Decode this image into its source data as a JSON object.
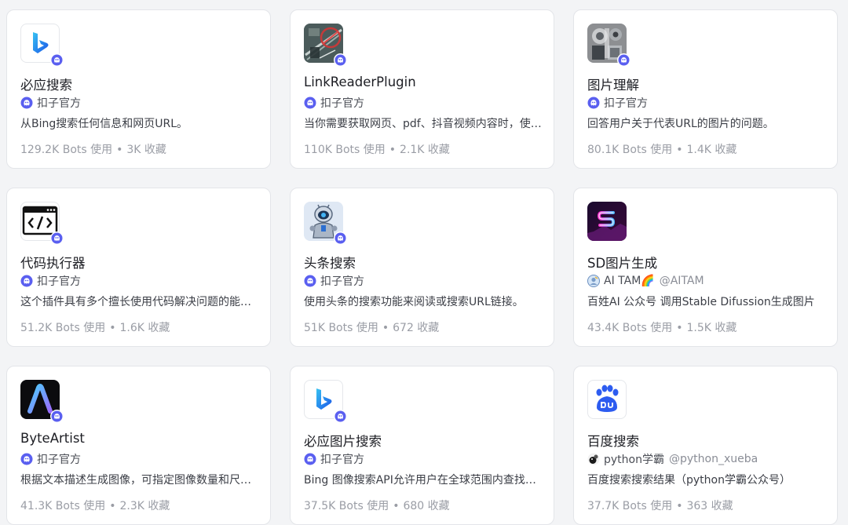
{
  "plugins": [
    {
      "icon": "bing-logo-icon",
      "title": "必应搜索",
      "author": "扣子官方",
      "description": "从Bing搜索任何信息和网页URL。",
      "bots": "129.2K Bots 使用",
      "favorites": "3K 收藏"
    },
    {
      "icon": "link-reader-icon",
      "title": "LinkReaderPlugin",
      "author": "扣子官方",
      "description": "当你需要获取网页、pdf、抖音视频内容时，使用此工具。",
      "bots": "110K Bots 使用",
      "favorites": "2.1K 收藏"
    },
    {
      "icon": "image-understanding-icon",
      "title": "图片理解",
      "author": "扣子官方",
      "description": "回答用户关于代表URL的图片的问题。",
      "bots": "80.1K Bots 使用",
      "favorites": "1.4K 收藏"
    },
    {
      "icon": "code-terminal-icon",
      "title": "代码执行器",
      "author": "扣子官方",
      "description": "这个插件具有多个擅长使用代码解决问题的能力。",
      "bots": "51.2K Bots 使用",
      "favorites": "1.6K 收藏"
    },
    {
      "icon": "robot-search-icon",
      "title": "头条搜索",
      "author": "扣子官方",
      "description": "使用头条的搜索功能来阅读或搜索URL链接。",
      "bots": "51K Bots 使用",
      "favorites": "672 收藏"
    },
    {
      "icon": "sd-generate-icon",
      "title": "SD图片生成",
      "author": "AI TAM🌈",
      "handle": "@AITAM",
      "description": "百姓AI 公众号 调用Stable Difussion生成图片",
      "bots": "43.4K Bots 使用",
      "favorites": "1.5K 收藏"
    },
    {
      "icon": "byteartist-logo-icon",
      "title": "ByteArtist",
      "author": "扣子官方",
      "description": "根据文本描述生成图像，可指定图像数量和尺寸。",
      "bots": "41.3K Bots 使用",
      "favorites": "2.3K 收藏"
    },
    {
      "icon": "bing-logo-icon",
      "title": "必应图片搜索",
      "author": "扣子官方",
      "description": "Bing 图像搜索API允许用户在全球范围内查找高质量的图片。",
      "bots": "37.5K Bots 使用",
      "favorites": "680 收藏"
    },
    {
      "icon": "baidu-logo-icon",
      "title": "百度搜索",
      "author": "python学霸",
      "handle": "@python_xueba",
      "description": "百度搜索搜索结果（python学霸公众号）",
      "bots": "37.7K Bots 使用",
      "favorites": "363 收藏"
    }
  ],
  "separator": "•",
  "colors": {
    "official_badge": "#5a5ff0",
    "bing_blue": "#1b6ff5",
    "baidu_blue": "#2d5cf0"
  }
}
